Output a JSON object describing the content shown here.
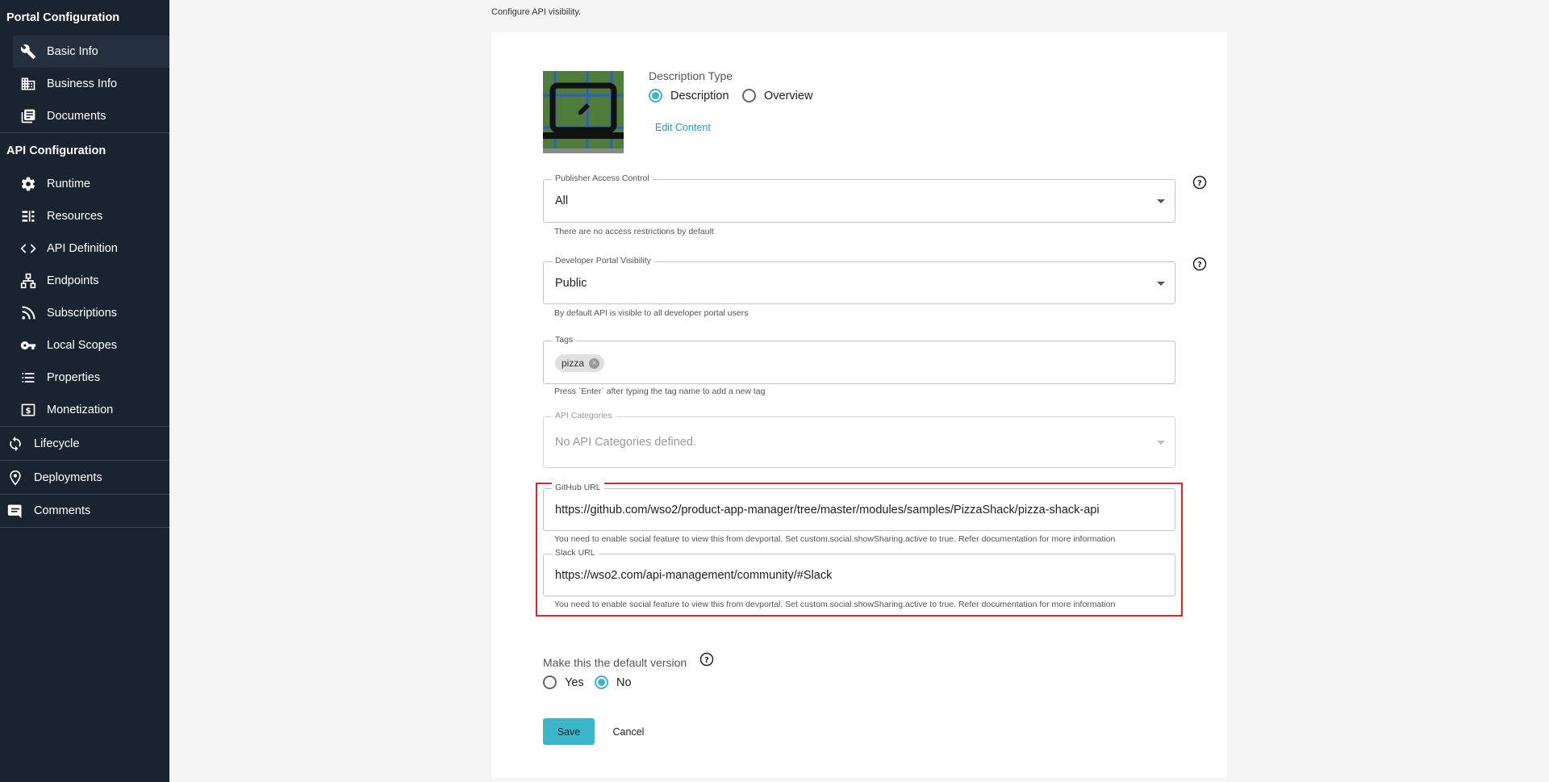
{
  "sidebar": {
    "portal_section": "Portal Configuration",
    "portal_items": [
      {
        "label": "Basic Info",
        "icon": "wrench-icon",
        "active": true
      },
      {
        "label": "Business Info",
        "icon": "building-icon",
        "active": false
      },
      {
        "label": "Documents",
        "icon": "documents-icon",
        "active": false
      }
    ],
    "api_section": "API Configuration",
    "api_items": [
      {
        "label": "Runtime",
        "icon": "gear-icon"
      },
      {
        "label": "Resources",
        "icon": "resources-icon"
      },
      {
        "label": "API Definition",
        "icon": "code-icon"
      },
      {
        "label": "Endpoints",
        "icon": "endpoints-icon"
      },
      {
        "label": "Subscriptions",
        "icon": "rss-icon"
      },
      {
        "label": "Local Scopes",
        "icon": "key-icon"
      },
      {
        "label": "Properties",
        "icon": "list-icon"
      },
      {
        "label": "Monetization",
        "icon": "dollar-icon"
      }
    ],
    "top_items": [
      {
        "label": "Lifecycle",
        "icon": "cycle-icon"
      },
      {
        "label": "Deployments",
        "icon": "location-icon"
      },
      {
        "label": "Comments",
        "icon": "comment-icon"
      }
    ]
  },
  "header": {
    "subtitle": "Configure API visibility."
  },
  "description": {
    "type_label": "Description Type",
    "options": [
      "Description",
      "Overview"
    ],
    "selected": "Description",
    "edit_link": "Edit Content"
  },
  "publisher_access": {
    "legend": "Publisher Access Control",
    "value": "All",
    "helper": "There are no access restrictions by default"
  },
  "dev_portal": {
    "legend": "Developer Portal Visibility",
    "value": "Public",
    "helper": "By default API is visible to all developer portal users"
  },
  "tags": {
    "legend": "Tags",
    "chips": [
      "pizza"
    ],
    "helper": "Press `Enter` after typing the tag name to add a new tag"
  },
  "categories": {
    "legend": "API Categories",
    "value": "No API Categories defined."
  },
  "github": {
    "legend": "GitHub URL",
    "value": "https://github.com/wso2/product-app-manager/tree/master/modules/samples/PizzaShack/pizza-shack-api",
    "helper": "You need to enable social feature to view this from devportal. Set custom.social.showSharing.active to true. Refer documentation for more information"
  },
  "slack": {
    "legend": "Slack URL",
    "value": "https://wso2.com/api-management/community/#Slack",
    "helper": "You need to enable social feature to view this from devportal. Set custom.social.showSharing.active to true. Refer documentation for more information"
  },
  "default_version": {
    "label": "Make this the default version",
    "options": [
      "Yes",
      "No"
    ],
    "selected": "No"
  },
  "actions": {
    "save": "Save",
    "cancel": "Cancel"
  },
  "colors": {
    "sidebar_bg": "#1a2330",
    "accent": "#3bb5c9",
    "highlight_border": "#e02424"
  }
}
